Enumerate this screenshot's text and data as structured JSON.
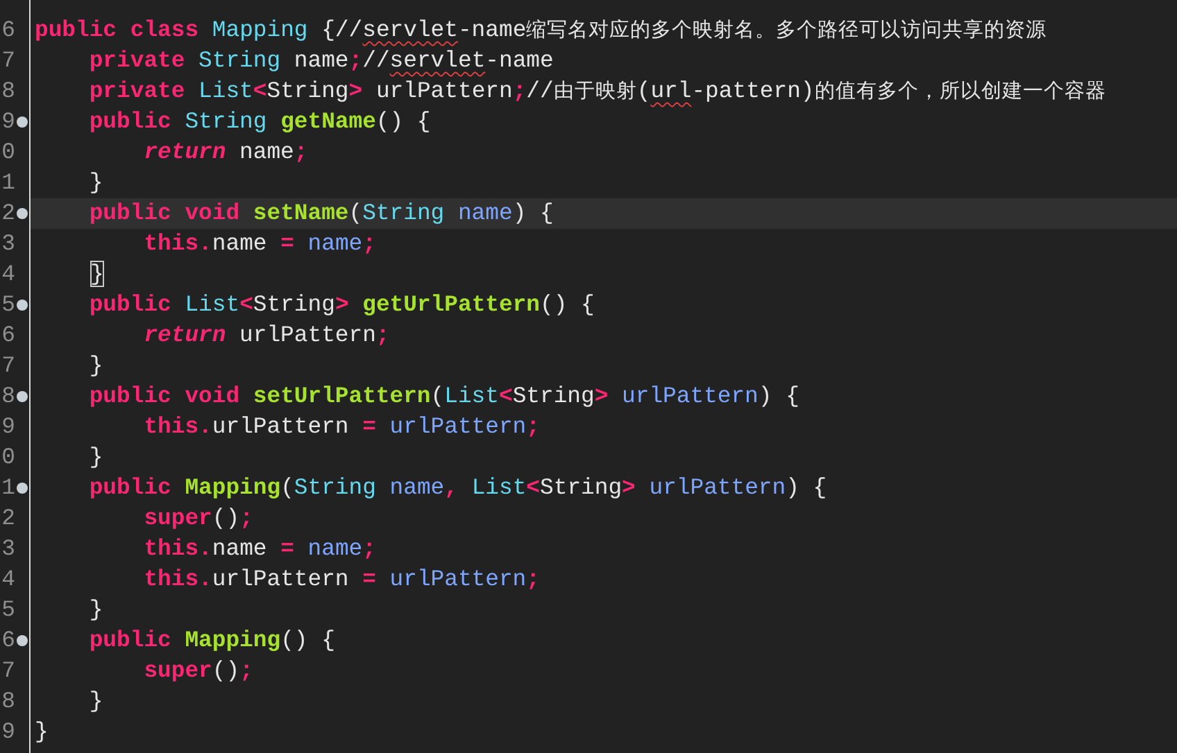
{
  "editor": {
    "lines": [
      {
        "number": "6",
        "fold": false,
        "current": false,
        "tokens": [
          {
            "kind": "kw",
            "t": "public "
          },
          {
            "kind": "kw",
            "t": "class "
          },
          {
            "kind": "type",
            "t": "Mapping "
          },
          {
            "kind": "plain",
            "t": "{//"
          },
          {
            "kind": "misspelled",
            "t": "servlet"
          },
          {
            "kind": "plain",
            "t": "-name缩写名对应的多个映射名。多个路径可以访问共享的资源"
          }
        ]
      },
      {
        "number": "7",
        "fold": false,
        "current": false,
        "tokens": [
          {
            "kind": "kw",
            "t": "    private "
          },
          {
            "kind": "type",
            "t": "String "
          },
          {
            "kind": "plain",
            "t": "name"
          },
          {
            "kind": "op",
            "t": ";"
          },
          {
            "kind": "plain",
            "t": "//"
          },
          {
            "kind": "misspelled",
            "t": "servlet"
          },
          {
            "kind": "plain",
            "t": "-name"
          }
        ]
      },
      {
        "number": "8",
        "fold": false,
        "current": false,
        "tokens": [
          {
            "kind": "kw",
            "t": "    private "
          },
          {
            "kind": "type",
            "t": "List"
          },
          {
            "kind": "op",
            "t": "<"
          },
          {
            "kind": "plain",
            "t": "String"
          },
          {
            "kind": "op",
            "t": ">"
          },
          {
            "kind": "plain",
            "t": " urlPattern"
          },
          {
            "kind": "op",
            "t": ";"
          },
          {
            "kind": "plain",
            "t": "//由于映射("
          },
          {
            "kind": "misspelled",
            "t": "url"
          },
          {
            "kind": "plain",
            "t": "-pattern)的值有多个，所以创建一个容器"
          }
        ]
      },
      {
        "number": "9",
        "fold": true,
        "current": false,
        "tokens": [
          {
            "kind": "kw",
            "t": "    public "
          },
          {
            "kind": "type",
            "t": "String "
          },
          {
            "kind": "fn",
            "t": "getName"
          },
          {
            "kind": "plain",
            "t": "() {"
          }
        ]
      },
      {
        "number": "0",
        "fold": false,
        "current": false,
        "tokens": [
          {
            "kind": "kwi",
            "t": "        return "
          },
          {
            "kind": "plain",
            "t": "name"
          },
          {
            "kind": "op",
            "t": ";"
          }
        ]
      },
      {
        "number": "1",
        "fold": false,
        "current": false,
        "tokens": [
          {
            "kind": "plain",
            "t": "    }"
          }
        ]
      },
      {
        "number": "2",
        "fold": true,
        "current": true,
        "tokens": [
          {
            "kind": "kw",
            "t": "    public "
          },
          {
            "kind": "kw",
            "t": "void "
          },
          {
            "kind": "fn",
            "t": "setName"
          },
          {
            "kind": "plain",
            "t": "("
          },
          {
            "kind": "type",
            "t": "String "
          },
          {
            "kind": "param",
            "t": "name"
          },
          {
            "kind": "plain",
            "t": ") {"
          }
        ]
      },
      {
        "number": "3",
        "fold": false,
        "current": false,
        "tokens": [
          {
            "kind": "kw",
            "t": "        this"
          },
          {
            "kind": "op",
            "t": "."
          },
          {
            "kind": "plain",
            "t": "name "
          },
          {
            "kind": "op",
            "t": "= "
          },
          {
            "kind": "param",
            "t": "name"
          },
          {
            "kind": "op",
            "t": ";"
          }
        ]
      },
      {
        "number": "4",
        "fold": false,
        "current": false,
        "tokens": [
          {
            "kind": "bracket",
            "t": "}"
          }
        ]
      },
      {
        "number": "5",
        "fold": true,
        "current": false,
        "tokens": [
          {
            "kind": "kw",
            "t": "    public "
          },
          {
            "kind": "type",
            "t": "List"
          },
          {
            "kind": "op",
            "t": "<"
          },
          {
            "kind": "plain",
            "t": "String"
          },
          {
            "kind": "op",
            "t": "> "
          },
          {
            "kind": "fn",
            "t": "getUrlPattern"
          },
          {
            "kind": "plain",
            "t": "() {"
          }
        ]
      },
      {
        "number": "6",
        "fold": false,
        "current": false,
        "tokens": [
          {
            "kind": "kwi",
            "t": "        return "
          },
          {
            "kind": "plain",
            "t": "urlPattern"
          },
          {
            "kind": "op",
            "t": ";"
          }
        ]
      },
      {
        "number": "7",
        "fold": false,
        "current": false,
        "tokens": [
          {
            "kind": "plain",
            "t": "    }"
          }
        ]
      },
      {
        "number": "8",
        "fold": true,
        "current": false,
        "tokens": [
          {
            "kind": "kw",
            "t": "    public "
          },
          {
            "kind": "kw",
            "t": "void "
          },
          {
            "kind": "fn",
            "t": "setUrlPattern"
          },
          {
            "kind": "plain",
            "t": "("
          },
          {
            "kind": "type",
            "t": "List"
          },
          {
            "kind": "op",
            "t": "<"
          },
          {
            "kind": "plain",
            "t": "String"
          },
          {
            "kind": "op",
            "t": "> "
          },
          {
            "kind": "param",
            "t": "urlPattern"
          },
          {
            "kind": "plain",
            "t": ") {"
          }
        ]
      },
      {
        "number": "9",
        "fold": false,
        "current": false,
        "tokens": [
          {
            "kind": "kw",
            "t": "        this"
          },
          {
            "kind": "op",
            "t": "."
          },
          {
            "kind": "plain",
            "t": "urlPattern "
          },
          {
            "kind": "op",
            "t": "= "
          },
          {
            "kind": "param",
            "t": "urlPattern"
          },
          {
            "kind": "op",
            "t": ";"
          }
        ]
      },
      {
        "number": "0",
        "fold": false,
        "current": false,
        "tokens": [
          {
            "kind": "plain",
            "t": "    }"
          }
        ]
      },
      {
        "number": "1",
        "fold": true,
        "current": false,
        "tokens": [
          {
            "kind": "kw",
            "t": "    public "
          },
          {
            "kind": "fn",
            "t": "Mapping"
          },
          {
            "kind": "plain",
            "t": "("
          },
          {
            "kind": "type",
            "t": "String "
          },
          {
            "kind": "param",
            "t": "name"
          },
          {
            "kind": "op",
            "t": ", "
          },
          {
            "kind": "type",
            "t": "List"
          },
          {
            "kind": "op",
            "t": "<"
          },
          {
            "kind": "plain",
            "t": "String"
          },
          {
            "kind": "op",
            "t": "> "
          },
          {
            "kind": "param",
            "t": "urlPattern"
          },
          {
            "kind": "plain",
            "t": ") {"
          }
        ]
      },
      {
        "number": "2",
        "fold": false,
        "current": false,
        "tokens": [
          {
            "kind": "kw",
            "t": "        super"
          },
          {
            "kind": "plain",
            "t": "()"
          },
          {
            "kind": "op",
            "t": ";"
          }
        ]
      },
      {
        "number": "3",
        "fold": false,
        "current": false,
        "tokens": [
          {
            "kind": "kw",
            "t": "        this"
          },
          {
            "kind": "op",
            "t": "."
          },
          {
            "kind": "plain",
            "t": "name "
          },
          {
            "kind": "op",
            "t": "= "
          },
          {
            "kind": "param",
            "t": "name"
          },
          {
            "kind": "op",
            "t": ";"
          }
        ]
      },
      {
        "number": "4",
        "fold": false,
        "current": false,
        "tokens": [
          {
            "kind": "kw",
            "t": "        this"
          },
          {
            "kind": "op",
            "t": "."
          },
          {
            "kind": "plain",
            "t": "urlPattern "
          },
          {
            "kind": "op",
            "t": "= "
          },
          {
            "kind": "param",
            "t": "urlPattern"
          },
          {
            "kind": "op",
            "t": ";"
          }
        ]
      },
      {
        "number": "5",
        "fold": false,
        "current": false,
        "tokens": [
          {
            "kind": "plain",
            "t": "    }"
          }
        ]
      },
      {
        "number": "6",
        "fold": true,
        "current": false,
        "tokens": [
          {
            "kind": "kw",
            "t": "    public "
          },
          {
            "kind": "fn",
            "t": "Mapping"
          },
          {
            "kind": "plain",
            "t": "() {"
          }
        ]
      },
      {
        "number": "7",
        "fold": false,
        "current": false,
        "tokens": [
          {
            "kind": "kw",
            "t": "        super"
          },
          {
            "kind": "plain",
            "t": "()"
          },
          {
            "kind": "op",
            "t": ";"
          }
        ]
      },
      {
        "number": "8",
        "fold": false,
        "current": false,
        "tokens": [
          {
            "kind": "plain",
            "t": "    }"
          }
        ]
      },
      {
        "number": "9",
        "fold": false,
        "current": false,
        "tokens": [
          {
            "kind": "plain",
            "t": "}"
          }
        ]
      }
    ]
  }
}
